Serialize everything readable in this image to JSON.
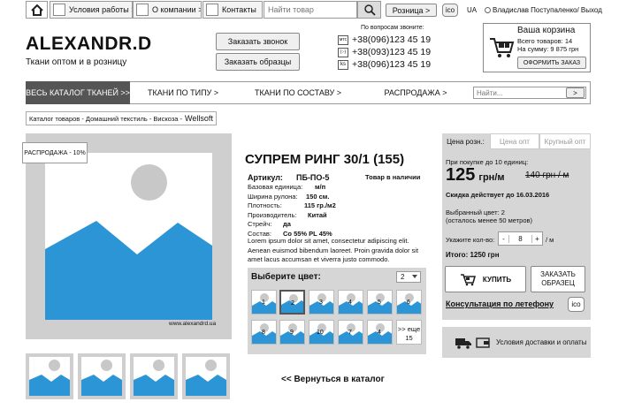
{
  "topbar": {
    "home": "",
    "items": [
      "Условия работы >",
      "О компании >",
      "Контакты"
    ],
    "search_placeholder": "Найти товар",
    "price_type": "Розница >",
    "ico": "ico",
    "lang": "UA",
    "user": "Владислав Поступаленко/ Выход"
  },
  "header": {
    "logo": "ALEXANDR.D",
    "tagline": "Ткани оптом и в розницу",
    "call_button": "Заказать звонок",
    "samples_button": "Заказать образцы",
    "phones_title": "По вопросам звоните:",
    "phones": [
      {
        "op": "мтс",
        "num": "+38(096)123 45 19"
      },
      {
        "op": "life",
        "num": "+38(093)123 45 19"
      },
      {
        "op": "ks",
        "num": "+38(096)123 45 19"
      }
    ],
    "cart_title": "Ваша корзина",
    "cart_items": "Всего товаров: 14",
    "cart_sum": "На сумму: 9 875 грн",
    "cart_button": "ОФОРМИТЬ ЗАКАЗ"
  },
  "nav": {
    "tabs": [
      "ВЕСЬ КАТАЛОГ ТКАНЕЙ >>",
      "ТКАНИ ПО ТИПУ >",
      "ТКАНИ ПО СОСТАВУ >",
      "РАСПРОДАЖА >"
    ],
    "search_placeholder": "Найти...",
    "search_button": ">"
  },
  "breadcrumb": {
    "path": "Каталог товаров  - Домашний текстиль - Вискоза -",
    "current": "Wellsoft"
  },
  "product": {
    "sale_badge": "РАСПРОДАЖА - 10%",
    "watermark": "www.alexandrd.ua",
    "title": "СУПРЕМ РИНГ 30/1 (155)",
    "article_label": "Артикул:",
    "article_value": "ПБ-ПО-5",
    "stock": "Товар в наличии",
    "specs": [
      {
        "label": "Базовая единица:",
        "value": "м/п"
      },
      {
        "label": "Ширина рулона:",
        "value": "150 см."
      },
      {
        "label": "Плотность:",
        "value": "115 гр./м2"
      },
      {
        "label": "Производитель:",
        "value": "Китай"
      },
      {
        "label": "Стрейч:",
        "value": "да"
      },
      {
        "label": "Состав:",
        "value": "Со 55% PL 45%"
      }
    ],
    "description": "Lorem ipsum dolor sit amet, consectetur adipiscing elit. Aenean euismod bibendum laoreet. Proin gravida dolor sit amet lacus accumsan et viverra justo commodo.",
    "color_label": "Выберите цвет:",
    "color_select": "2",
    "swatches": [
      "1",
      "2",
      "3",
      "4",
      "5",
      "6",
      "8",
      "9",
      "10",
      "7",
      "4"
    ],
    "more_colors": ">> еще 15",
    "back_link": "<< Вернуться в каталог"
  },
  "price_panel": {
    "tabs": [
      "Цена розн.:",
      "Цена опт",
      "Крупный опт"
    ],
    "until_text": "При покупке до 10 единиц:",
    "price": "125",
    "unit": "грн/м",
    "old_price": "140 грн / м",
    "discount_text": "Скидка действует до 16.03.2016",
    "chosen_color": "Выбранный цвет: 2",
    "remaining": "(осталось менее 50 метров)",
    "qty_label": "Укажите кол-во:",
    "qty_minus": "-",
    "qty_value": "8",
    "qty_plus": "+",
    "qty_unit": "/ м",
    "total": "Итого: 1250 грн",
    "buy_button": "КУПИТЬ",
    "sample_button": "ЗАКАЗАТЬ ОБРАЗЕЦ",
    "phone_consult": "Консультация по летефону",
    "ico": "ico"
  },
  "delivery": {
    "label": "Условия доставки и оплаты"
  },
  "colors": {
    "accent_blue": "#2b95d6",
    "dark_nav": "#555555",
    "placeholder_gray": "#c8c8c8"
  }
}
